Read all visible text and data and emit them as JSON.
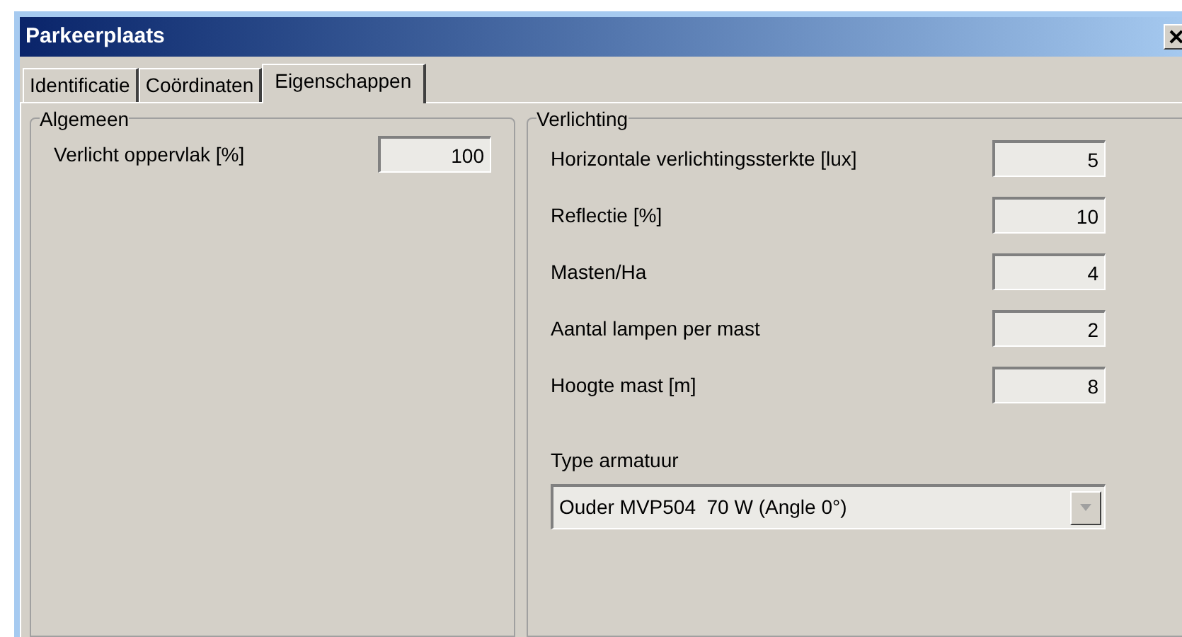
{
  "window": {
    "title": "Parkeerplaats"
  },
  "tabs": [
    {
      "label": "Identificatie",
      "selected": false
    },
    {
      "label": "Coördinaten",
      "selected": false
    },
    {
      "label": "Eigenschappen",
      "selected": true
    }
  ],
  "algemeen": {
    "title": "Algemeen",
    "fields": [
      {
        "label": "Verlicht oppervlak [%]",
        "value": "100"
      }
    ]
  },
  "verlichting": {
    "title": "Verlichting",
    "fields": [
      {
        "label": "Horizontale verlichtingssterkte [lux]",
        "value": "5"
      },
      {
        "label": "Reflectie [%]",
        "value": "10"
      },
      {
        "label": "Masten/Ha",
        "value": "4"
      },
      {
        "label": "Aantal lampen per mast",
        "value": "2"
      },
      {
        "label": "Hoogte mast [m]",
        "value": "8"
      }
    ],
    "armatuur": {
      "label": "Type armatuur",
      "value": "Ouder MVP504  70 W (Angle 0°)",
      "disabled": true
    }
  }
}
